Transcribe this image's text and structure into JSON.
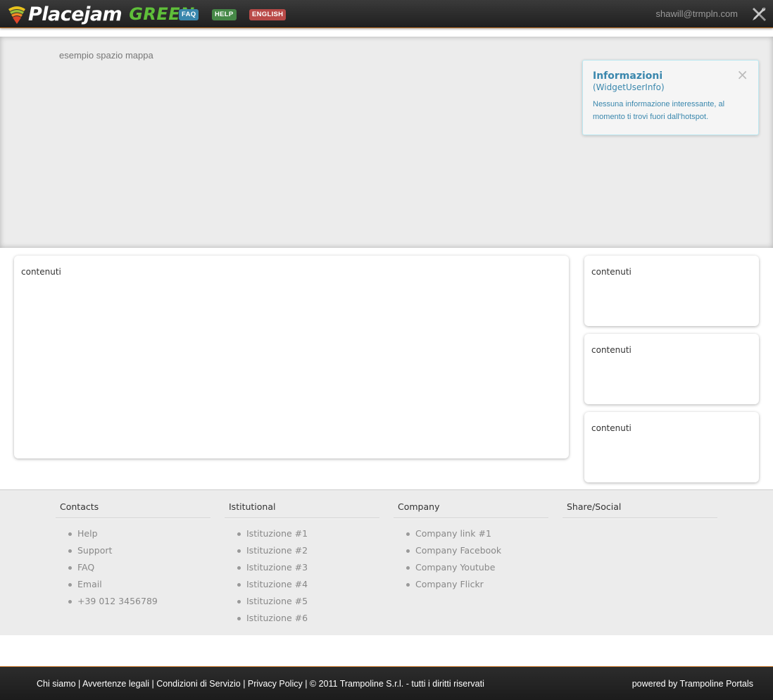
{
  "header": {
    "logo_text": "Placejam",
    "logo_variant": "GREEN",
    "badges": {
      "faq": "FAQ",
      "help": "HELP",
      "english": "ENGLISH"
    },
    "user_email": "shawill@trmpln.com",
    "tools_icon": "tools-icon"
  },
  "map": {
    "placeholder": "esempio spazio mappa",
    "info_widget": {
      "title": "Informazioni",
      "subtitle": "(WidgetUserInfo)",
      "text": "Nessuna informazione interessante, al momento ti trovi fuori dall'hotspot.",
      "close": "×"
    }
  },
  "content": {
    "main": "contenuti",
    "side": [
      "contenuti",
      "contenuti",
      "contenuti"
    ]
  },
  "footer": {
    "columns": [
      {
        "title": "Contacts",
        "items": [
          "Help",
          "Support",
          "FAQ",
          "Email",
          "+39 012 3456789"
        ]
      },
      {
        "title": "Istitutional",
        "items": [
          "Istituzione #1",
          "Istituzione #2",
          "Istituzione #3",
          "Istituzione #4",
          "Istituzione #5",
          "Istituzione #6"
        ]
      },
      {
        "title": "Company",
        "items": [
          "Company link #1",
          "Company Facebook",
          "Company Youtube",
          "Company Flickr"
        ]
      },
      {
        "title": "Share/Social",
        "items": []
      }
    ],
    "bottom_left": "Chi siamo | Avvertenze legali | Condizioni di Servizio | Privacy Policy | © 2011 Trampoline S.r.l. - tutti i diritti riservati",
    "bottom_right": "powered by Trampoline Portals"
  },
  "colors": {
    "accent_orange": "#c8772a",
    "badge_faq": "#3a87ad",
    "badge_help": "#468847",
    "badge_english": "#b94a48",
    "logo_green": "#5fbf3a"
  }
}
